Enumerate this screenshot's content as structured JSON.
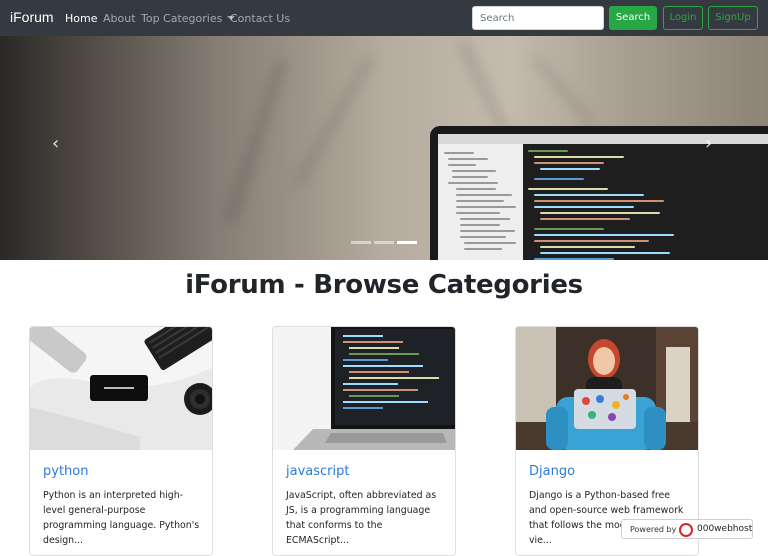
{
  "navbar": {
    "brand": "iForum",
    "links": {
      "home": "Home",
      "about": "About",
      "top_categories": "Top Categories",
      "contact": "Contact Us"
    },
    "search": {
      "placeholder": "Search",
      "button": "Search"
    },
    "login": "Login",
    "signup": "SignUp"
  },
  "carousel": {
    "prev_icon": "chevron-left-icon",
    "next_icon": "chevron-right-icon",
    "prev_glyph": "‹",
    "next_glyph": "›",
    "slide_count": 3,
    "active_slide": 3
  },
  "main": {
    "title": "iForum - Browse Categories"
  },
  "categories": [
    {
      "title": "python",
      "text": "Python is an interpreted high-level general-purpose programming language. Python's design..."
    },
    {
      "title": "javascript",
      "text": "JavaScript, often abbreviated as JS, is a programming language that conforms to the ECMAScript..."
    },
    {
      "title": "Django",
      "text": "Django is a Python-based free and open-source web framework that follows the model–template–vie..."
    }
  ],
  "badge": {
    "label": "Powered by",
    "host": "000webhost"
  },
  "colors": {
    "navbar_bg": "#343a40",
    "success": "#28a745",
    "link": "#2b7bd8"
  }
}
